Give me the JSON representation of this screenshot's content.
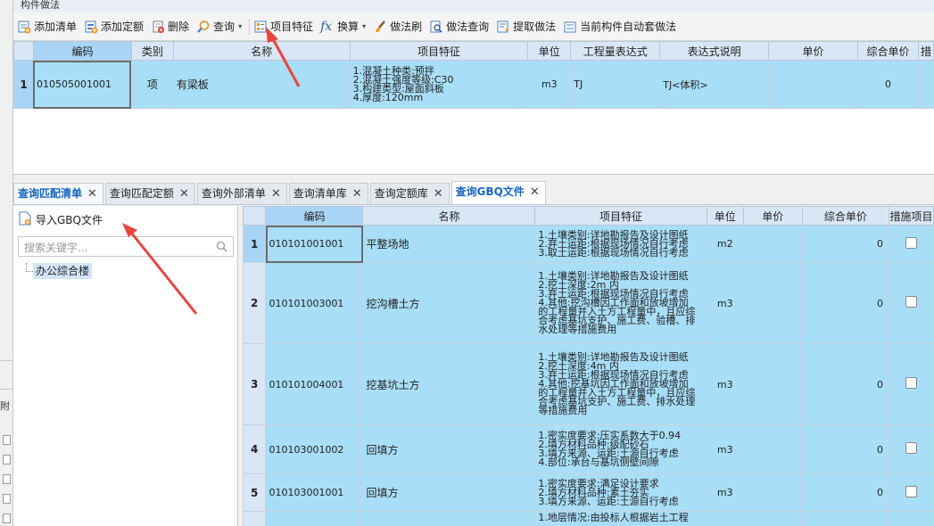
{
  "panel": {
    "title": "构件做法"
  },
  "toolbar": {
    "add_list": "添加清单",
    "add_quota": "添加定额",
    "delete": "删除",
    "query": "查询",
    "feature": "项目特征",
    "convert": "换算",
    "method_brush": "做法刷",
    "method_query": "做法查询",
    "extract": "提取做法",
    "auto_apply": "当前构件自动套做法",
    "fx": "fx",
    "dd": "▾"
  },
  "top_table": {
    "headers": [
      "编码",
      "类别",
      "名称",
      "项目特征",
      "单位",
      "工程量表达式",
      "表达式说明",
      "单价",
      "综合单价",
      "措"
    ],
    "rows": [
      {
        "no": "1",
        "code": "010505001001",
        "type": "项",
        "name": "有梁板",
        "features": [
          "1.混凝土种类:预拌",
          "2.混凝土强度等级:C30",
          "3.构建类型:屋面斜板",
          "4.厚度:120mm"
        ],
        "unit": "m3",
        "expr": "TJ",
        "expr_desc": "TJ<体积>",
        "price": "",
        "comp_price": "0"
      }
    ]
  },
  "tabs": [
    {
      "label": "查询匹配清单",
      "close": "✕"
    },
    {
      "label": "查询匹配定额",
      "close": "✕"
    },
    {
      "label": "查询外部清单",
      "close": "✕"
    },
    {
      "label": "查询清单库",
      "close": "✕"
    },
    {
      "label": "查询定额库",
      "close": "✕"
    },
    {
      "label": "查询GBQ文件",
      "close": "✕"
    }
  ],
  "gbq": {
    "import_label": "导入GBQ文件",
    "search_placeholder": "搜索关键字...",
    "tree": [
      "办公综合楼"
    ]
  },
  "bottom_table": {
    "headers": [
      "编码",
      "名称",
      "项目特征",
      "单位",
      "单价",
      "综合单价",
      "措施项目"
    ],
    "rows": [
      {
        "no": "1",
        "code": "010101001001",
        "name": "平整场地",
        "features": [
          "1.土壤类别:详地勘报告及设计图纸",
          "2.弃土运距:根据现场情况自行考虑",
          "3.取土运距:根据现场情况自行考虑"
        ],
        "unit": "m2",
        "price": "",
        "comp_price": "0"
      },
      {
        "no": "2",
        "code": "010101003001",
        "name": "挖沟槽土方",
        "features": [
          "1.土壤类别:详地勘报告及设计图纸",
          "2.挖土深度:2m 内",
          "3.弃土运距:根据现场情况自行考虑",
          "4.其他:挖沟槽因工作面和放坡增加",
          "的工程量并入土方工程量中，且应综",
          "合考虑基坑支护、施工费、验槽、排",
          "水处理等措施费用"
        ],
        "unit": "m3",
        "price": "",
        "comp_price": "0"
      },
      {
        "no": "3",
        "code": "010101004001",
        "name": "挖基坑土方",
        "features": [
          "1.土壤类别:详地勘报告及设计图纸",
          "2.挖土深度:4m 内",
          "3.弃土运距:根据现场情况自行考虑",
          "4.其他:挖基坑因工作面和放坡增加",
          "的工程量并入土方工程量中，且应综",
          "合考虑基坑支护、施工费、排水处理",
          "等措施费用"
        ],
        "unit": "m3",
        "price": "",
        "comp_price": "0"
      },
      {
        "no": "4",
        "code": "010103001002",
        "name": "回填方",
        "features": [
          "1.密实度要求:压实系数大于0.94",
          "2.填方材料品种:级配砂石",
          "3.填方来源、运距:土源自行考虑",
          "4.部位:承台与基坑侧壁间隙"
        ],
        "unit": "m3",
        "price": "",
        "comp_price": "0"
      },
      {
        "no": "5",
        "code": "010103001001",
        "name": "回填方",
        "features": [
          "1.密实度要求:满足设计要求",
          "2.填方材料品种:素土夯实",
          "3.填方来源、运距:土源自行考虑"
        ],
        "unit": "m3",
        "price": "",
        "comp_price": "0"
      },
      {
        "no": "",
        "code": "",
        "name": "",
        "features": [
          "1.地层情况:由投标人根据岩土工程"
        ],
        "unit": "",
        "price": "",
        "comp_price": ""
      }
    ]
  },
  "leftstrip": {
    "label": "附"
  },
  "colors": {
    "header": "#d9e6f5",
    "selected_row": "#a8def7",
    "accent": "#1565c0",
    "arrow": "#e8453c"
  }
}
